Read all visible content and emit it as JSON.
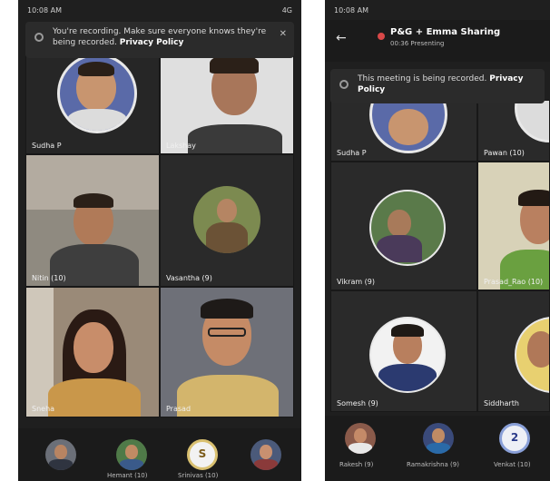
{
  "left": {
    "status_time": "10:08 AM",
    "status_right": "4G",
    "banner_text": "You're recording. Make sure everyone knows they're being recorded.",
    "banner_link": "Privacy Policy",
    "tiles": [
      {
        "name": "Sudha P"
      },
      {
        "name": "Lakshay"
      },
      {
        "name": "Nitin (10)"
      },
      {
        "name": "Vasantha (9)"
      },
      {
        "name": "Sneha"
      },
      {
        "name": "Prasad"
      }
    ],
    "thumbs": [
      {
        "label": ""
      },
      {
        "label": "Hemant (10)"
      },
      {
        "label": "Srinivas (10)",
        "initial": "S"
      },
      {
        "label": ""
      }
    ]
  },
  "right": {
    "status_time": "10:08 AM",
    "title": "P&G + Emma Sharing",
    "subtitle": "00:36  Presenting",
    "banner_text": "This meeting is being recorded.",
    "banner_link": "Privacy Policy",
    "tiles": [
      {
        "name": "Sudha P"
      },
      {
        "name": "Pawan (10)"
      },
      {
        "name": "Vikram (9)"
      },
      {
        "name": "Prasad_Rao (10)"
      },
      {
        "name": "Somesh (9)"
      },
      {
        "name": "Siddharth"
      }
    ],
    "thumbs": [
      {
        "label": "Rakesh (9)"
      },
      {
        "label": "Ramakrishna (9)"
      },
      {
        "label": "Venkat (10)",
        "initial": "2"
      }
    ]
  }
}
